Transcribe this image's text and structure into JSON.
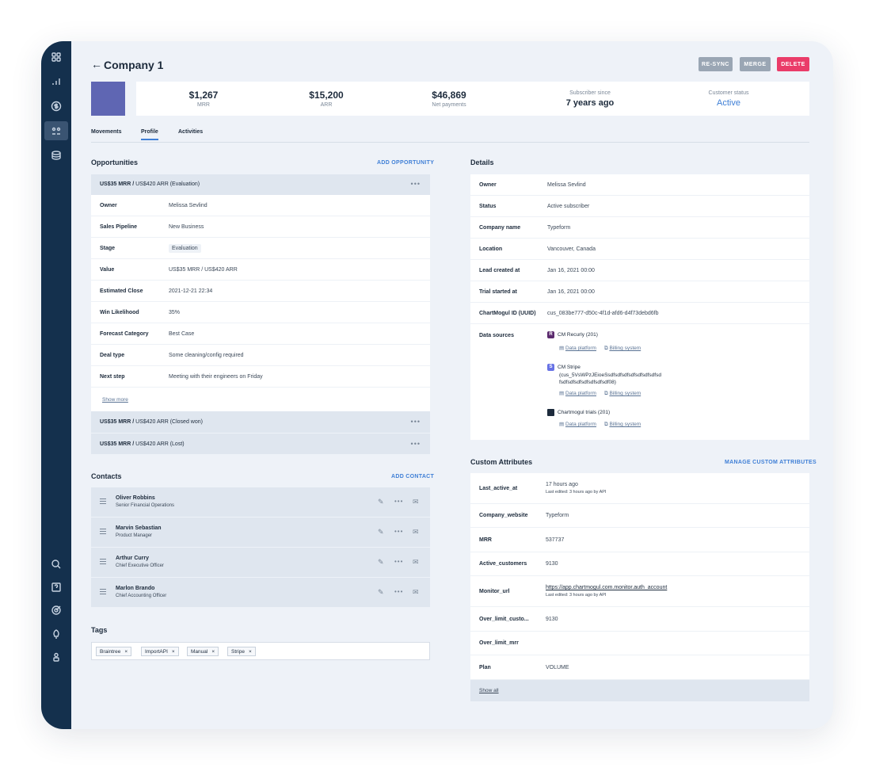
{
  "sidebar": {
    "icons": [
      "dashboard-icon",
      "analytics-icon",
      "dollar-icon",
      "customers-icon",
      "database-icon",
      "search-icon",
      "help-icon",
      "target-icon",
      "rocket-icon",
      "user-icon"
    ]
  },
  "header": {
    "back": "←",
    "title": "Company 1",
    "resync": "RE-SYNC",
    "merge": "MERGE",
    "delete": "DELETE"
  },
  "colors": {
    "accent": "#3f7fd6",
    "delete": "#ea3c69",
    "sidebar": "#14304d",
    "avatar": "#5f66b3"
  },
  "stats": {
    "mrr_value": "$1,267",
    "mrr_label": "MRR",
    "arr_value": "$15,200",
    "arr_label": "ARR",
    "net_value": "$46,869",
    "net_label": "Net payments",
    "since_label": "Subscriber since",
    "since_value": "7 years ago",
    "status_label": "Customer status",
    "status_value": "Active"
  },
  "tabs": [
    "Movements",
    "Profile",
    "Activities"
  ],
  "opportunities": {
    "title": "Opportunities",
    "add": "ADD OPPORTUNITY",
    "first_head_bold": "US$35 MRR /",
    "first_head_rest": " US$420 ARR (Evaluation)",
    "rows": [
      {
        "k": "Owner",
        "v": "Melissa Sevlind"
      },
      {
        "k": "Sales Pipeline",
        "v": "New Business"
      },
      {
        "k": "Stage",
        "v": "Evaluation"
      },
      {
        "k": "Value",
        "v": "US$35 MRR / US$420 ARR"
      },
      {
        "k": "Estimated Close",
        "v": "2021-12-21 22:34"
      },
      {
        "k": "Win Likelihood",
        "v": "35%"
      },
      {
        "k": "Forecast Category",
        "v": "Best Case"
      },
      {
        "k": "Deal type",
        "v": "Some cleaning/config required"
      },
      {
        "k": "Next step",
        "v": "Meeting with their engineers on Friday"
      }
    ],
    "show_more": "Show more",
    "second_head_bold": "US$35 MRR /",
    "second_head_rest": " US$420 ARR (Closed won)",
    "third_head_bold": "US$35 MRR /",
    "third_head_rest": " US$420 ARR (Lost)"
  },
  "contacts": {
    "title": "Contacts",
    "add": "ADD CONTACT",
    "items": [
      {
        "name": "Oliver Robbins",
        "role": "Senior Financial Operations"
      },
      {
        "name": "Marvin Sebastian",
        "role": "Product Manager"
      },
      {
        "name": "Arthur Curry",
        "role": "Chief Executive Officer"
      },
      {
        "name": "Marlon Brando",
        "role": "Chief Accounting Officer"
      }
    ]
  },
  "tags": {
    "title": "Tags",
    "items": [
      "Braintree",
      "ImportAPI",
      "Manual",
      "Stripe"
    ],
    "remove": "×"
  },
  "details": {
    "title": "Details",
    "rows": [
      {
        "k": "Owner",
        "v": "Melissa Sevlind"
      },
      {
        "k": "Status",
        "v": "Active subscriber"
      },
      {
        "k": "Company name",
        "v": "Typeform"
      },
      {
        "k": "Location",
        "v": "Vancouver, Canada"
      },
      {
        "k": "Lead created at",
        "v": "Jan 16, 2021 00:00"
      },
      {
        "k": "Trial started at",
        "v": "Jan 16, 2021 00:00"
      },
      {
        "k": "ChartMogul ID (UUID)",
        "v": "cus_083be777-d50c-4f1d-afd6-d4f73debd6fb"
      }
    ],
    "ds_label": "Data sources",
    "ds1_name": "CM Recurly (201)",
    "ds1_icon": "R",
    "ds2_name": "CM Stripe",
    "ds2_line2": "(cus_5VsWPzJEioeSsdfsdfsdfsdfsdfsdfsdfsd",
    "ds2_line3": "fsdfsdfsdfsdfsdfsdfsdf08)",
    "ds2_icon": "S",
    "ds3_name": "Chartmogul trials (201)",
    "link_platform": "Data platform",
    "link_billing": "Billing system"
  },
  "custom": {
    "title": "Custom Attributes",
    "manage": "MANAGE CUSTOM ATTRIBUTES",
    "rows": [
      {
        "k": "Last_active_at",
        "v": "17 hours ago",
        "sub": "Last edited: 3 hours ago by API"
      },
      {
        "k": "Company_website",
        "v": "Typeform"
      },
      {
        "k": "MRR",
        "v": "537737"
      },
      {
        "k": "Active_customers",
        "v": "9130"
      },
      {
        "k": "Monitor_url",
        "v": "https://app.chartmogul.com.monitor.auth_account",
        "sub": "Last edited: 3 hours ago by API"
      },
      {
        "k": "Over_limit_custo...",
        "v": "9130"
      },
      {
        "k": "Over_limit_mrr",
        "v": ""
      },
      {
        "k": "Plan",
        "v": "VOLUME"
      }
    ],
    "show_all": "Show all"
  }
}
